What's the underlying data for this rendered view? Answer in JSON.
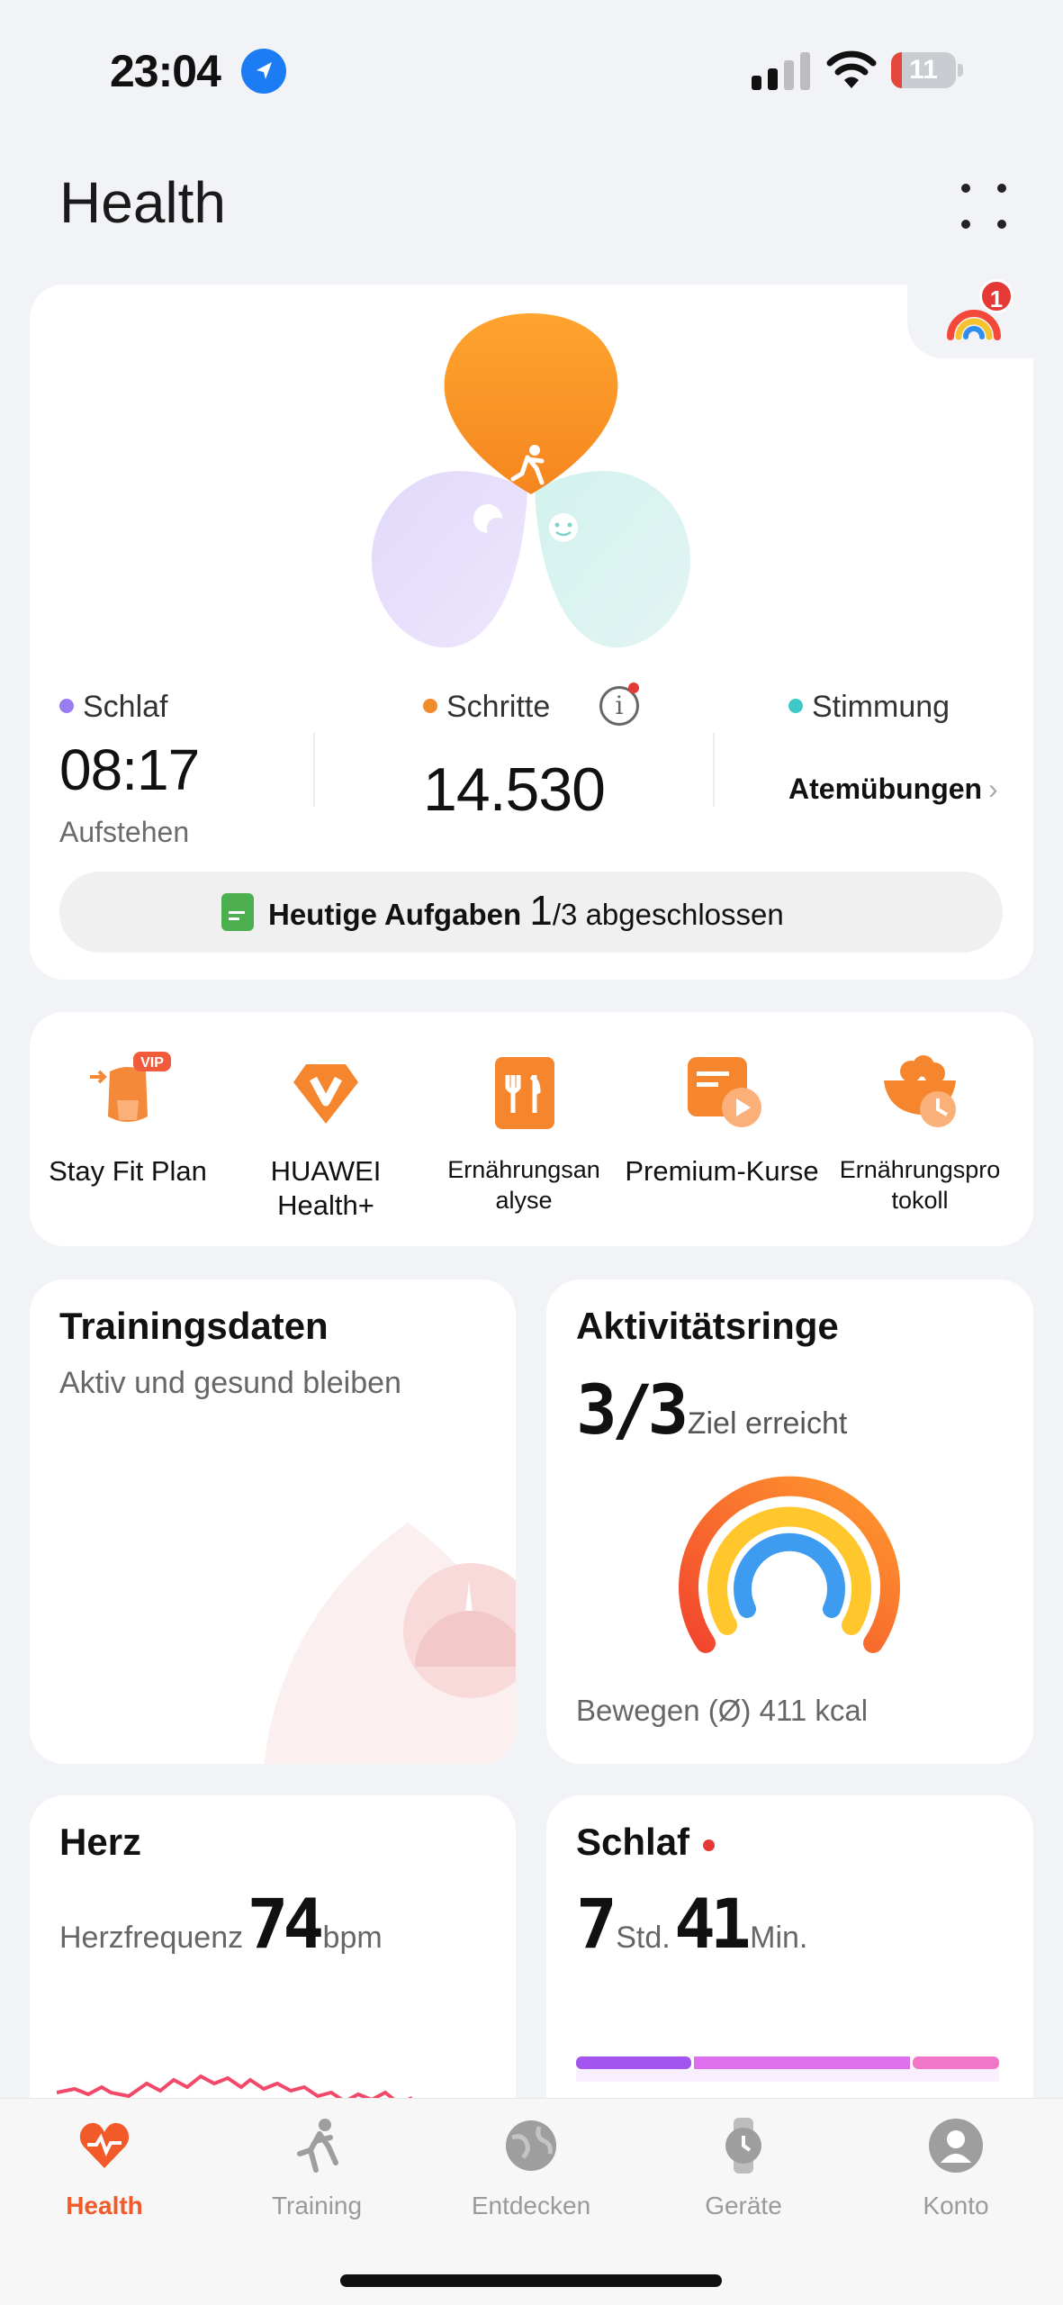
{
  "status_bar": {
    "time": "23:04",
    "battery": "11"
  },
  "header": {
    "title": "Health"
  },
  "main_card": {
    "badge_count": "1",
    "sleep": {
      "label": "Schlaf",
      "value": "08:17",
      "sub": "Aufstehen",
      "color": "#9B7BF2"
    },
    "steps": {
      "label": "Schritte",
      "value": "14.530",
      "color": "#F28B2A"
    },
    "mood": {
      "label": "Stimmung",
      "link": "Atemübungen",
      "color": "#3CC8C8"
    },
    "tasks": {
      "label": "Heutige Aufgaben",
      "done": "1",
      "rest": "/3 abgeschlossen"
    }
  },
  "shortcuts": [
    {
      "label": "Stay Fit Plan",
      "icon": "stay-fit-vip-icon",
      "badge": "VIP"
    },
    {
      "label": "HUAWEI Health+",
      "icon": "huawei-health-plus-icon"
    },
    {
      "label": "Ernährungsan alyse",
      "icon": "nutrition-analysis-icon"
    },
    {
      "label": "Premium-Kurse",
      "icon": "premium-courses-icon"
    },
    {
      "label": "Ernährungspro tokoll",
      "icon": "nutrition-log-icon"
    }
  ],
  "training": {
    "title": "Trainingsdaten",
    "subtitle": "Aktiv und gesund bleiben"
  },
  "activity": {
    "title": "Aktivitätsringe",
    "value": "3/3",
    "unit": "Ziel erreicht",
    "footer": "Bewegen (Ø) 411 kcal",
    "rings_progress": [
      1,
      1,
      1
    ]
  },
  "heart": {
    "title": "Herz",
    "label": "Herzfrequenz",
    "value": "74",
    "unit": "bpm"
  },
  "sleep_tile": {
    "title": "Schlaf",
    "hours": "7",
    "hours_unit": "Std.",
    "minutes": "41",
    "minutes_unit": "Min."
  },
  "tabs": [
    {
      "label": "Health",
      "active": true,
      "icon": "heart-icon"
    },
    {
      "label": "Training",
      "active": false,
      "icon": "runner-icon"
    },
    {
      "label": "Entdecken",
      "active": false,
      "icon": "globe-icon"
    },
    {
      "label": "Geräte",
      "active": false,
      "icon": "watch-icon"
    },
    {
      "label": "Konto",
      "active": false,
      "icon": "person-icon"
    }
  ]
}
